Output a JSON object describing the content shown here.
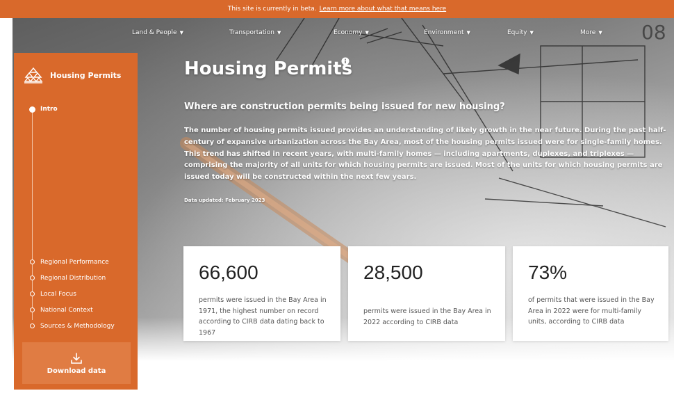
{
  "beta_banner": {
    "text": "This site is currently in beta.",
    "link": "Learn more about what that means here"
  },
  "nav": {
    "items": [
      {
        "label": "Land & People"
      },
      {
        "label": "Transportation"
      },
      {
        "label": "Economy"
      },
      {
        "label": "Environment"
      },
      {
        "label": "Equity"
      },
      {
        "label": "More"
      }
    ]
  },
  "sidebar": {
    "title": "Housing Permits",
    "items": [
      {
        "label": "Intro",
        "active": true
      },
      {
        "label": "Regional Performance"
      },
      {
        "label": "Regional Distribution"
      },
      {
        "label": "Local Focus"
      },
      {
        "label": "National Context"
      },
      {
        "label": "Sources & Methodology"
      }
    ],
    "download_label": "Download data"
  },
  "hero": {
    "title": "Housing Permits",
    "subtitle": "Where are construction permits being issued for new housing?",
    "body": "The number of housing permits issued provides an understanding of likely growth in the near future. During the past half-century of expansive urbanization across the Bay Area, most of the housing permits issued were for single-family homes. This trend has shifted in recent years, with multi-family homes — including apartments, duplexes, and triplexes — comprising the majority of all units for which housing permits are issued. Most of the units for which housing permits are issued today will be constructed within the next few years.",
    "updated": "Data updated: February 2023"
  },
  "stats": [
    {
      "value": "66,600",
      "desc": "permits were issued in the Bay Area in 1971, the highest number on record according to CIRB data dating back to 1967"
    },
    {
      "value": "28,500",
      "desc": "permits were issued in the Bay Area in 2022 according to CIRB data"
    },
    {
      "value": "73%",
      "desc": "of permits that were issued in the Bay Area in 2022 were for multi-family units, according to CIRB data"
    }
  ],
  "colors": {
    "accent": "#d9692b",
    "accent_light": "#e07c43"
  }
}
